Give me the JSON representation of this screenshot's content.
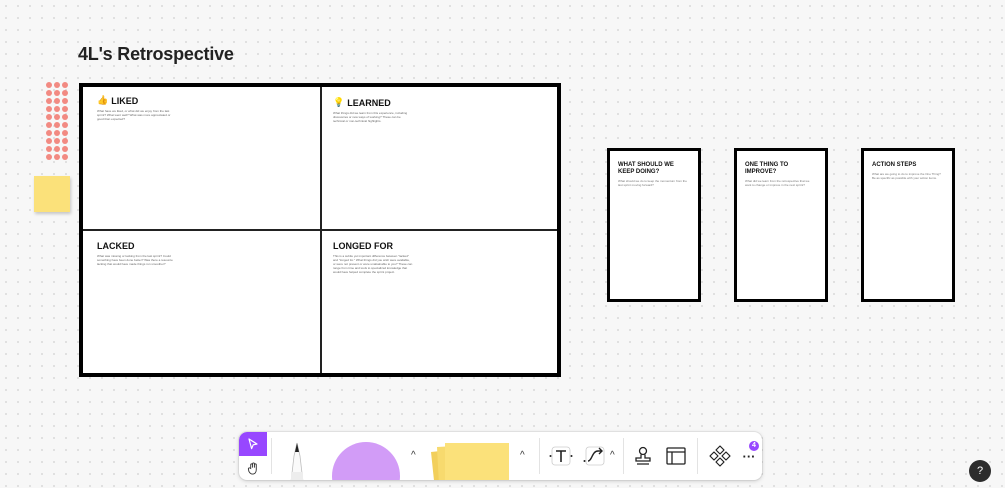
{
  "board_title": "4L's Retrospective",
  "quadrants": {
    "liked": {
      "icon": "👍",
      "title": "LIKED",
      "description": "What have we liked, or what did we enjoy from the last sprint? What went well? What was more appreciated or good than expected?"
    },
    "learned": {
      "icon": "💡",
      "title": "LEARNED",
      "description": "What things did we learn from this experience, including discoveries or new ways of working? These can be technical or non-technical highlights."
    },
    "lacked": {
      "title": "LACKED",
      "description": "What was missing or lacking from the last sprint? Could something have been done better? Was there a resource lacking that would have made things run smoother?"
    },
    "longed_for": {
      "title": "LONGED FOR",
      "description": "This is a subtle yet important difference between \"lacked\" and \"longed for.\" What things did you wish were available, or were not present or were unattainable to you? These can range from time and tools to specialized knowledge that would have helped complete the sprint project."
    }
  },
  "cards": [
    {
      "title": "WHAT SHOULD WE KEEP DOING?",
      "description": "What should we do to keep the momentum from the last sprint moving forward?"
    },
    {
      "title": "ONE THING TO IMPROVE?",
      "description": "What did we learn from the retrospective that we want to change or improve in the next sprint?"
    },
    {
      "title": "ACTION STEPS",
      "description": "What are we going to do to improve the One Thing? Be as specific as possible with your action items."
    }
  ],
  "toolbar": {
    "badge_count": "4",
    "more_label": "···"
  },
  "help_label": "?",
  "colors": {
    "accent": "#9747ff",
    "shape_purple": "#d29cf7",
    "sticky_yellow": "#fbe17a",
    "dots_salmon": "#f28a82"
  }
}
